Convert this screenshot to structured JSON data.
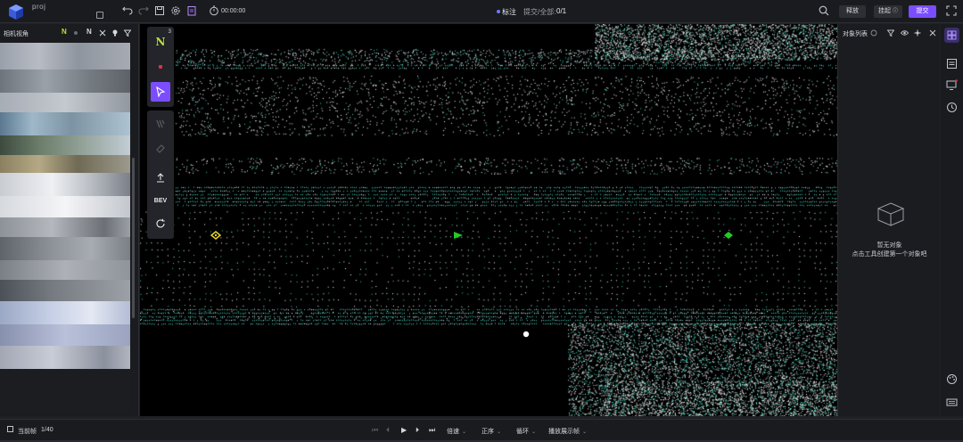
{
  "header": {
    "project_name": "proj",
    "project_path": "",
    "timer": "00:00:00",
    "mode_label": "标注",
    "submit_label": "提交/全部:",
    "submit_count": "0/1",
    "buttons": {
      "release": "释放",
      "suspend": "挂起",
      "submit": "提交"
    },
    "icons": [
      "undo-icon",
      "redo-icon",
      "save-icon",
      "settings-icon",
      "clipboard-icon",
      "timer-icon",
      "search-icon",
      "fullscreen-icon"
    ]
  },
  "left_panel": {
    "title": "相机视角",
    "north_label": "N",
    "icons": [
      "north-filter-icon",
      "dot-icon",
      "north-toggle-icon",
      "pin-icon",
      "bulb-icon",
      "filter-icon"
    ],
    "thumbnail_count": 16
  },
  "toolbar": {
    "north_label": "N",
    "north_superscript": "3",
    "bev_label": "BEV",
    "tools": [
      "north-tool",
      "point-tool",
      "select-tool",
      "cuboid-tool",
      "polygon-tool",
      "upload-tool",
      "bev-tool",
      "reset-view-tool"
    ]
  },
  "right_panel": {
    "title": "对象列表",
    "empty_title": "暂无对象",
    "empty_hint": "点击工具创建第一个对象吧",
    "icons": [
      "settings-icon",
      "filter-icon",
      "eye-icon",
      "cursor-icon",
      "close-icon"
    ]
  },
  "rail": {
    "icons": [
      "grid-icon",
      "list-icon",
      "monitor-icon",
      "history-icon",
      "palette-icon",
      "keyboard-icon"
    ]
  },
  "footer": {
    "current_frame_label": "当前帧",
    "frame_count": "1/40",
    "options": [
      "倍速",
      "正序",
      "循环",
      "播放展示帧"
    ]
  },
  "colors": {
    "accent": "#7b4dff",
    "point_white": "#ffffff",
    "point_teal": "#38d9c0",
    "marker_green": "#22cc22",
    "marker_yellow": "#e6d22a"
  }
}
